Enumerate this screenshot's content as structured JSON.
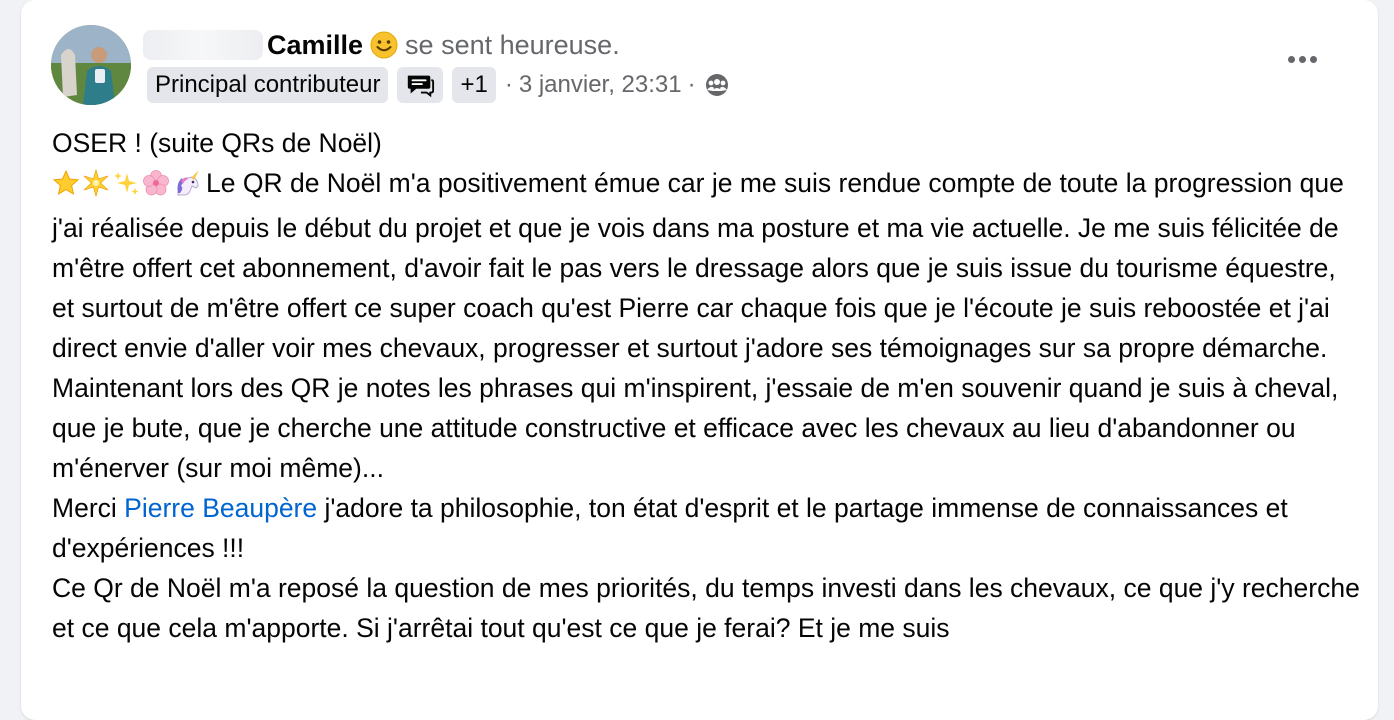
{
  "post": {
    "author_name": "Camille",
    "feeling_text": "se sent heureuse.",
    "badge_label": "Principal contributeur",
    "extra_badges": "+1",
    "timestamp": "3 janvier, 23:31",
    "separator": "·",
    "icons": {
      "feeling": "smiley-emoji-icon",
      "badge": "conversation-starter-icon",
      "privacy": "group-members-icon",
      "more": "more-options-icon",
      "emojis": [
        "star-emoji-icon",
        "glowing-star-emoji-icon",
        "sparkles-emoji-icon",
        "cherry-blossom-emoji-icon",
        "unicorn-emoji-icon"
      ]
    },
    "paragraphs": {
      "title": "OSER ! (suite QRs de Noël)",
      "p1": "Le QR de Noël m'a positivement émue car je me suis rendue compte de toute la progression que j'ai réalisée depuis le début du projet et que je vois dans ma posture et ma vie actuelle. Je me suis félicitée de m'être offert cet abonnement, d'avoir fait le pas vers le dressage alors que je suis issue du tourisme équestre, et surtout de m'être offert ce super coach qu'est Pierre car chaque fois que je l'écoute je suis reboostée et j'ai direct envie d'aller voir mes chevaux, progresser et surtout j'adore ses témoignages sur sa propre démarche.",
      "p2": "Maintenant lors des QR je notes les phrases qui m'inspirent, j'essaie de m'en souvenir quand je suis à cheval, que je bute, que je cherche une attitude constructive et efficace avec les chevaux au lieu d'abandonner ou m'énerver (sur moi même)...",
      "p3_prefix": "Merci ",
      "p3_mention": "Pierre Beaupère",
      "p3_suffix": " j'adore ta philosophie, ton état d'esprit et le partage immense de connaissances et d'expériences !!!",
      "p4": "Ce Qr de Noël m'a reposé la question de mes priorités, du temps investi dans les chevaux, ce que j'y recherche et ce que cela m'apporte. Si j'arrêtai tout qu'est ce que je ferai? Et je me suis"
    }
  }
}
